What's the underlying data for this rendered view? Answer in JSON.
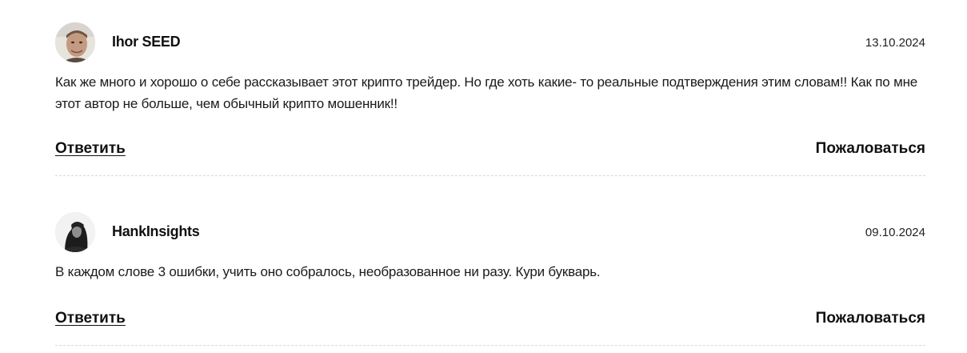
{
  "comments": [
    {
      "author": "Ihor SEED",
      "date": "13.10.2024",
      "text": "Как же много и хорошо о себе рассказывает этот крипто трейдер. Но где хоть какие- то реальные подтверждения этим словам!! Как по мне этот автор не больше, чем обычный крипто мошенник!!",
      "reply_label": "Ответить",
      "report_label": "Пожаловаться",
      "avatar_icon": "user-photo-icon"
    },
    {
      "author": "HankInsights",
      "date": "09.10.2024",
      "text": "В каждом слове 3 ошибки, учить оно собралось, необразованное ни разу. Кури букварь.",
      "reply_label": "Ответить",
      "report_label": "Пожаловаться",
      "avatar_icon": "user-photo-icon"
    }
  ],
  "colors": {
    "text": "#111111",
    "divider": "#d9d9d9",
    "background": "#ffffff"
  }
}
